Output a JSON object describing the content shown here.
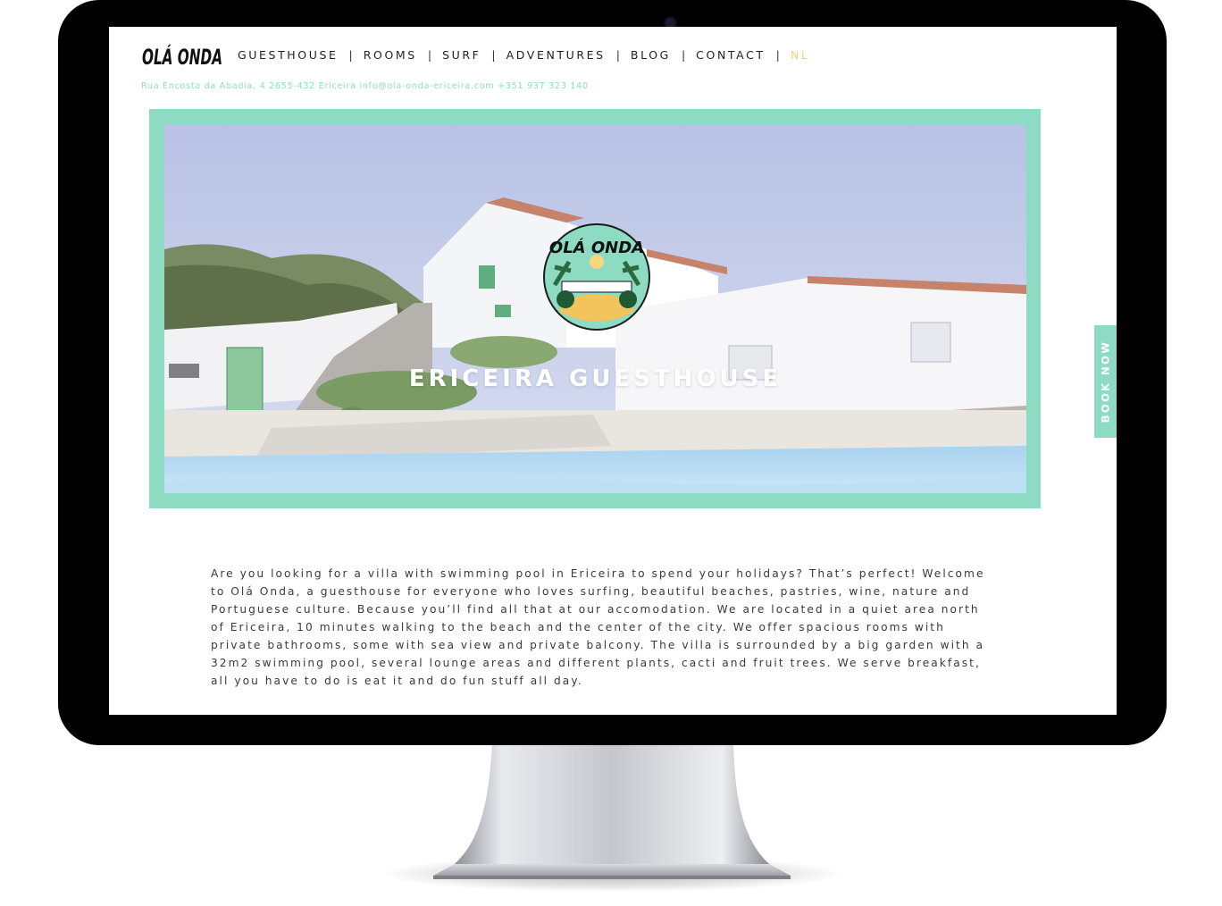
{
  "colors": {
    "accent": "#8edbc3",
    "nav_active": "#f2d377",
    "text": "#3a3a3a",
    "frame": "#000000"
  },
  "site": {
    "logo_text": "OLÁ ONDA",
    "nav": [
      {
        "label": "GUESTHOUSE"
      },
      {
        "label": "ROOMS"
      },
      {
        "label": "SURF"
      },
      {
        "label": "ADVENTURES"
      },
      {
        "label": "BLOG"
      },
      {
        "label": "CONTACT"
      },
      {
        "label": "NL"
      }
    ],
    "nav_separator": "|",
    "info_line": "Rua Encosta da Abadia, 4 2655-432 Ericeira info@ola-onda-ericeira.com +351 937 323 140",
    "hero": {
      "title": "ERICEIRA GUESTHOUSE",
      "badge_text": "OLÁ ONDA"
    },
    "book_now": "BOOK NOW",
    "intro": "Are you looking for a villa with swimming pool in Ericeira to spend your holidays? That’s perfect! Welcome to Olá Onda, a guesthouse for everyone who loves surfing, beautiful beaches, pastries, wine, nature and Portuguese culture. Because you’ll find all that at our accomodation. We are located in a quiet area north of Ericeira, 10 minutes walking to the beach and the center of the city. We offer spacious rooms with private bathrooms, some with sea view and private balcony. The villa is surrounded by a big garden with a 32m2 swimming pool, several lounge areas and different plants, cacti and fruit trees. We serve breakfast, all you have to do is eat it and do fun stuff all day."
  }
}
